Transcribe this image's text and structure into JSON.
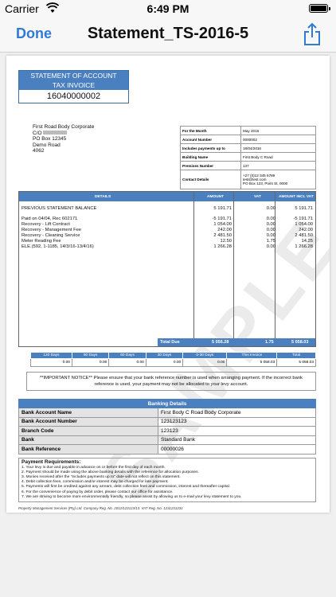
{
  "status": {
    "carrier": "Carrier",
    "time": "6:49 PM"
  },
  "nav": {
    "done_label": "Done",
    "title": "Statement_TS-2016-5",
    "share_icon": "share-icon"
  },
  "document": {
    "watermark": "SAMPLE",
    "title_box": {
      "line1": "STATEMENT OF ACCOUNT",
      "line2": "TAX INVOICE",
      "number": "16040000002"
    },
    "address": {
      "name": "First   Road Body Corporate",
      "co_prefix": "C/O",
      "line2": "PO Box 12345",
      "line3": "Demo     Road",
      "line4": "4062"
    },
    "info": {
      "month_label": "For the Month",
      "month_value": "May 2016",
      "account_label": "Account Number",
      "account_value": "0000002",
      "payments_label": "Includes payments up to",
      "payments_value": "18/04/2016",
      "building_label": "Building Name",
      "building_value": "First Body C Road",
      "premises_label": "Premises Number",
      "premises_value": "137",
      "contact_label": "Contact Details",
      "contact_phone": "+27 (0)12 345 6789",
      "contact_email": "test@test.com",
      "contact_box": "PO Box 123, Point St, 0000"
    },
    "details": {
      "headers": {
        "details": "DETAILS",
        "amount": "AMOUNT",
        "vat": "VAT",
        "incl": "AMOUNT INCL VAT"
      },
      "rows": [
        {
          "desc": "PREVIOUS STATEMENT BALANCE",
          "amount": "5 191.71",
          "vat": "0.00",
          "incl": "5 191.71"
        },
        {
          "desc": "Paid on 04/04, Rec 602171",
          "amount": "-5 191.71",
          "vat": "0.00",
          "incl": "-5 191.71"
        },
        {
          "desc": "Recovery - Lift Contract",
          "amount": "1 054.00",
          "vat": "0.00",
          "incl": "1 054.00"
        },
        {
          "desc": "Recovery - Management Fee",
          "amount": "242.00",
          "vat": "0.00",
          "incl": "242.00"
        },
        {
          "desc": "Recovery - Cleaning Service",
          "amount": "2 481.50",
          "vat": "0.00",
          "incl": "2 481.50"
        },
        {
          "desc": "Meter Reading Fee",
          "amount": "12.50",
          "vat": "1.75",
          "incl": "14.25"
        },
        {
          "desc": "ELE.(592, 1-1185, 14/3/16-13/4/16)",
          "amount": "1 266.28",
          "vat": "0.00",
          "incl": "1 266.28"
        }
      ],
      "total_label": "Total Due",
      "total_amount": "5 056.28",
      "total_vat": "1.75",
      "total_incl": "5 058.03"
    },
    "aging": {
      "headers": [
        "120 Days",
        "90 Days",
        "60 Days",
        "30 Days",
        "0-30 Days",
        "This Invoice",
        "Total"
      ],
      "values": [
        "0.00",
        "0.00",
        "0.00",
        "0.00",
        "0.00",
        "5 058.03",
        "5 058.03"
      ]
    },
    "notice": "**IMPORTANT NOTICE** Please ensure that your bank reference number is used when arranging payment. If the incorrect bank reference is used, your payment may not be allocated to your levy account.",
    "banking": {
      "title": "Banking Details",
      "rows": [
        {
          "label": "Bank Account Name",
          "value": "First Body C Road Body Corporate"
        },
        {
          "label": "Bank Account Number",
          "value": "123123123"
        },
        {
          "label": "Branch Code",
          "value": "123123"
        },
        {
          "label": "Bank",
          "value": "Standard Bank"
        },
        {
          "label": "Bank Reference",
          "value": "00000026"
        }
      ]
    },
    "requirements": {
      "title": "Payment Requirements:",
      "items": [
        "1. Your levy is due and payable in advance on or before the first day of each month.",
        "2. Payment should be made using the above banking details with the reference for allocation purposes.",
        "3. Monies received after the \"includes payments up to\" date will not reflect on this statement.",
        "4. Debit collection fees, commission and/or interest may be charged for late payment.",
        "5. Payments will first be credited against any arrears, debt collection fees and commission, interest and thereafter capital.",
        "6. For the convenience of paying by debit order, please contact our office for assistance.",
        "7. We are striving to become more environmentally friendly, so please assist by allowing us to e-mail your levy statement to you."
      ]
    },
    "footer": "Property Management Services (Pty) Ltd. Company Reg. No. 2012/123123/13. VAT Reg. No. 1231231231"
  }
}
